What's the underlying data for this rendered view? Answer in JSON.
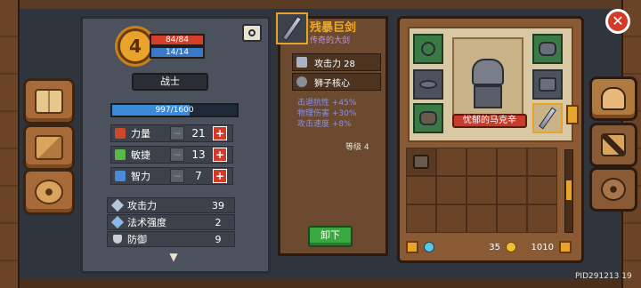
{
  "character": {
    "level": "4",
    "hp": "84/84",
    "mp": "14/14",
    "class_name": "战士",
    "xp": "997/1600",
    "xp_fraction": 0.623
  },
  "attributes": [
    {
      "name": "力量",
      "value": "21",
      "color": "#c84a2a"
    },
    {
      "name": "敏捷",
      "value": "13",
      "color": "#5ab84a"
    },
    {
      "name": "智力",
      "value": "7",
      "color": "#4a8ad8"
    }
  ],
  "combat_stats": [
    {
      "name": "攻击力",
      "value": "39"
    },
    {
      "name": "法术强度",
      "value": "2"
    },
    {
      "name": "防御",
      "value": "9"
    }
  ],
  "item": {
    "name": "残暴巨剑",
    "subtitle": "传奇的大剑",
    "stats": [
      {
        "label": "攻击力 28"
      },
      {
        "label": "狮子核心"
      }
    ],
    "bonuses": [
      "击退抗性 +45%",
      "物理伤害 +30%",
      "攻击速度 +8%"
    ],
    "level": "等级 4",
    "unequip_label": "卸下"
  },
  "hero": {
    "name": "忧郁的马克辛"
  },
  "currency": {
    "gems": "35",
    "coins": "1010"
  },
  "footer": {
    "pid": "PID291213 19"
  },
  "icons": {
    "close": "close-icon",
    "camera": "camera-icon"
  },
  "colors": {
    "hp": "#d2402c",
    "mp": "#3a78c8",
    "xp": "#3a8ad8",
    "legendary": "#f0a82a",
    "bonus": "#8a90e8",
    "unequip": "#3aa840"
  }
}
